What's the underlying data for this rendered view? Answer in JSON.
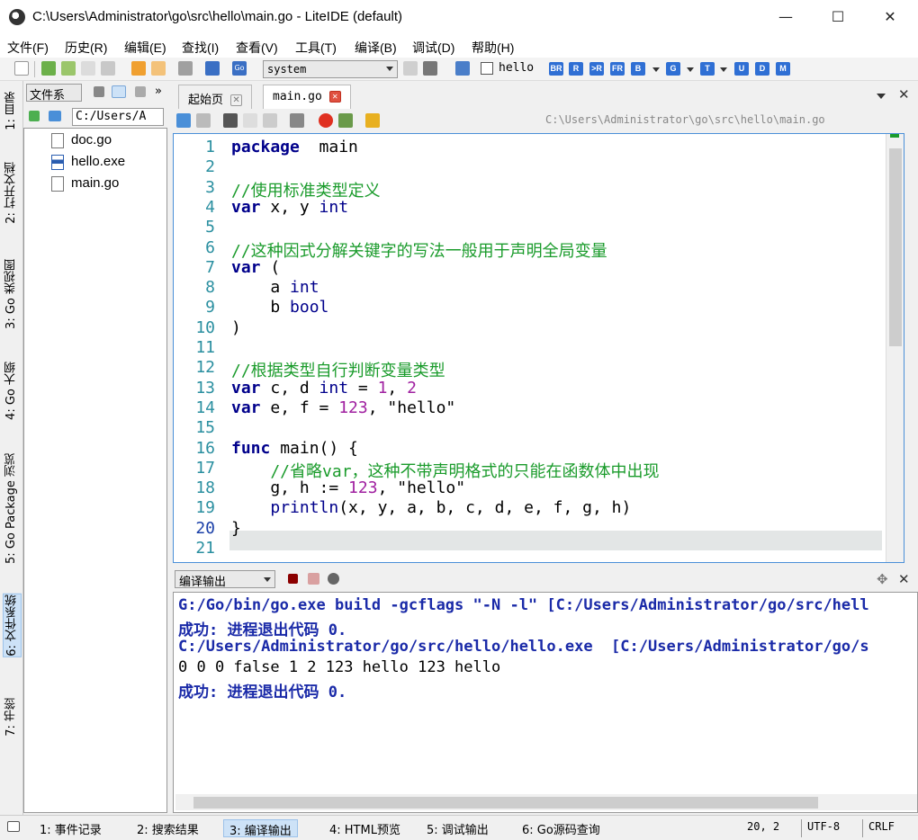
{
  "window": {
    "title": "C:\\Users\\Administrator\\go\\src\\hello\\main.go - LiteIDE (default)",
    "minimize": "—",
    "maximize": "☐",
    "close": "✕"
  },
  "menubar": [
    "文件(F)",
    "历史(R)",
    "编辑(E)",
    "查找(I)",
    "查看(V)",
    "工具(T)",
    "编译(B)",
    "调试(D)",
    "帮助(H)"
  ],
  "toolbar": {
    "env": "system",
    "target_label": "hello",
    "build_buttons": [
      "BR",
      "R",
      ">R",
      "FR",
      "B",
      "G",
      "T",
      "U",
      "D",
      "M"
    ]
  },
  "sidetabs": [
    "1: 目录",
    "2: 打开文档",
    "3: Go 类视图",
    "4: Go 大纲",
    "5: Go Package 浏览",
    "6: 文件系统",
    "7: 书签"
  ],
  "filesystem": {
    "combo": "文件系",
    "path": "C:/Users/A",
    "files": [
      "doc.go",
      "hello.exe",
      "main.go"
    ]
  },
  "tabs": [
    {
      "label": "起始页"
    },
    {
      "label": "main.go"
    }
  ],
  "breadcrumb": "C:\\Users\\Administrator\\go\\src\\hello\\main.go",
  "code": {
    "line_numbers": [
      "1",
      "2",
      "3",
      "4",
      "5",
      "6",
      "7",
      "8",
      "9",
      "10",
      "11",
      "12",
      "13",
      "14",
      "15",
      "16",
      "17",
      "18",
      "19",
      "20",
      "21"
    ],
    "lines": [
      [
        [
          "kw",
          "package"
        ],
        [
          "",
          "  main"
        ]
      ],
      [],
      [
        [
          "cm",
          "//使用标准类型定义"
        ]
      ],
      [
        [
          "kw",
          "var"
        ],
        [
          "",
          " x, y "
        ],
        [
          "ty",
          "int"
        ]
      ],
      [],
      [
        [
          "cm",
          "//这种因式分解关键字的写法一般用于声明全局变量"
        ]
      ],
      [
        [
          "kw",
          "var"
        ],
        [
          "",
          " ("
        ]
      ],
      [
        [
          "",
          "    a "
        ],
        [
          "ty",
          "int"
        ]
      ],
      [
        [
          "",
          "    b "
        ],
        [
          "ty",
          "bool"
        ]
      ],
      [
        [
          "",
          ")"
        ]
      ],
      [],
      [
        [
          "cm",
          "//根据类型自行判断变量类型"
        ]
      ],
      [
        [
          "kw",
          "var"
        ],
        [
          "",
          " c, d "
        ],
        [
          "ty",
          "int"
        ],
        [
          "",
          " = "
        ],
        [
          "num",
          "1"
        ],
        [
          "",
          ", "
        ],
        [
          "num",
          "2"
        ]
      ],
      [
        [
          "kw",
          "var"
        ],
        [
          "",
          " e, f = "
        ],
        [
          "num",
          "123"
        ],
        [
          "",
          ", \"hello\""
        ]
      ],
      [],
      [
        [
          "kw",
          "func"
        ],
        [
          "",
          " main() {"
        ]
      ],
      [
        [
          "cm",
          "    //省略var，这种不带声明格式的只能在函数体中出现"
        ]
      ],
      [
        [
          "",
          "    g, h := "
        ],
        [
          "num",
          "123"
        ],
        [
          "",
          ", \"hello\""
        ]
      ],
      [
        [
          "",
          "    "
        ],
        [
          "ty",
          "println"
        ],
        [
          "",
          "(x, y, a, b, c, d, e, f, g, h)"
        ]
      ],
      [
        [
          "",
          "}"
        ]
      ],
      []
    ]
  },
  "output": {
    "panel_title": "编译输出",
    "lines": [
      {
        "style": "blue",
        "text": "G:/Go/bin/go.exe build -gcflags \"-N -l\" [C:/Users/Administrator/go/src/hell"
      },
      {
        "style": "blue",
        "text": "成功: 进程退出代码 0."
      },
      {
        "style": "blue",
        "text": "C:/Users/Administrator/go/src/hello/hello.exe  [C:/Users/Administrator/go/s"
      },
      {
        "style": "plain",
        "text": "0 0 0 false 1 2 123 hello 123 hello"
      },
      {
        "style": "blue",
        "text": "成功: 进程退出代码 0."
      }
    ]
  },
  "statusbar": {
    "tabs": [
      "1: 事件记录",
      "2: 搜索结果",
      "3: 编译输出",
      "4: HTML预览",
      "5: 调试输出",
      "6: Go源码查询"
    ],
    "position": "20, 2",
    "encoding": "UTF-8",
    "eol": "CRLF"
  }
}
